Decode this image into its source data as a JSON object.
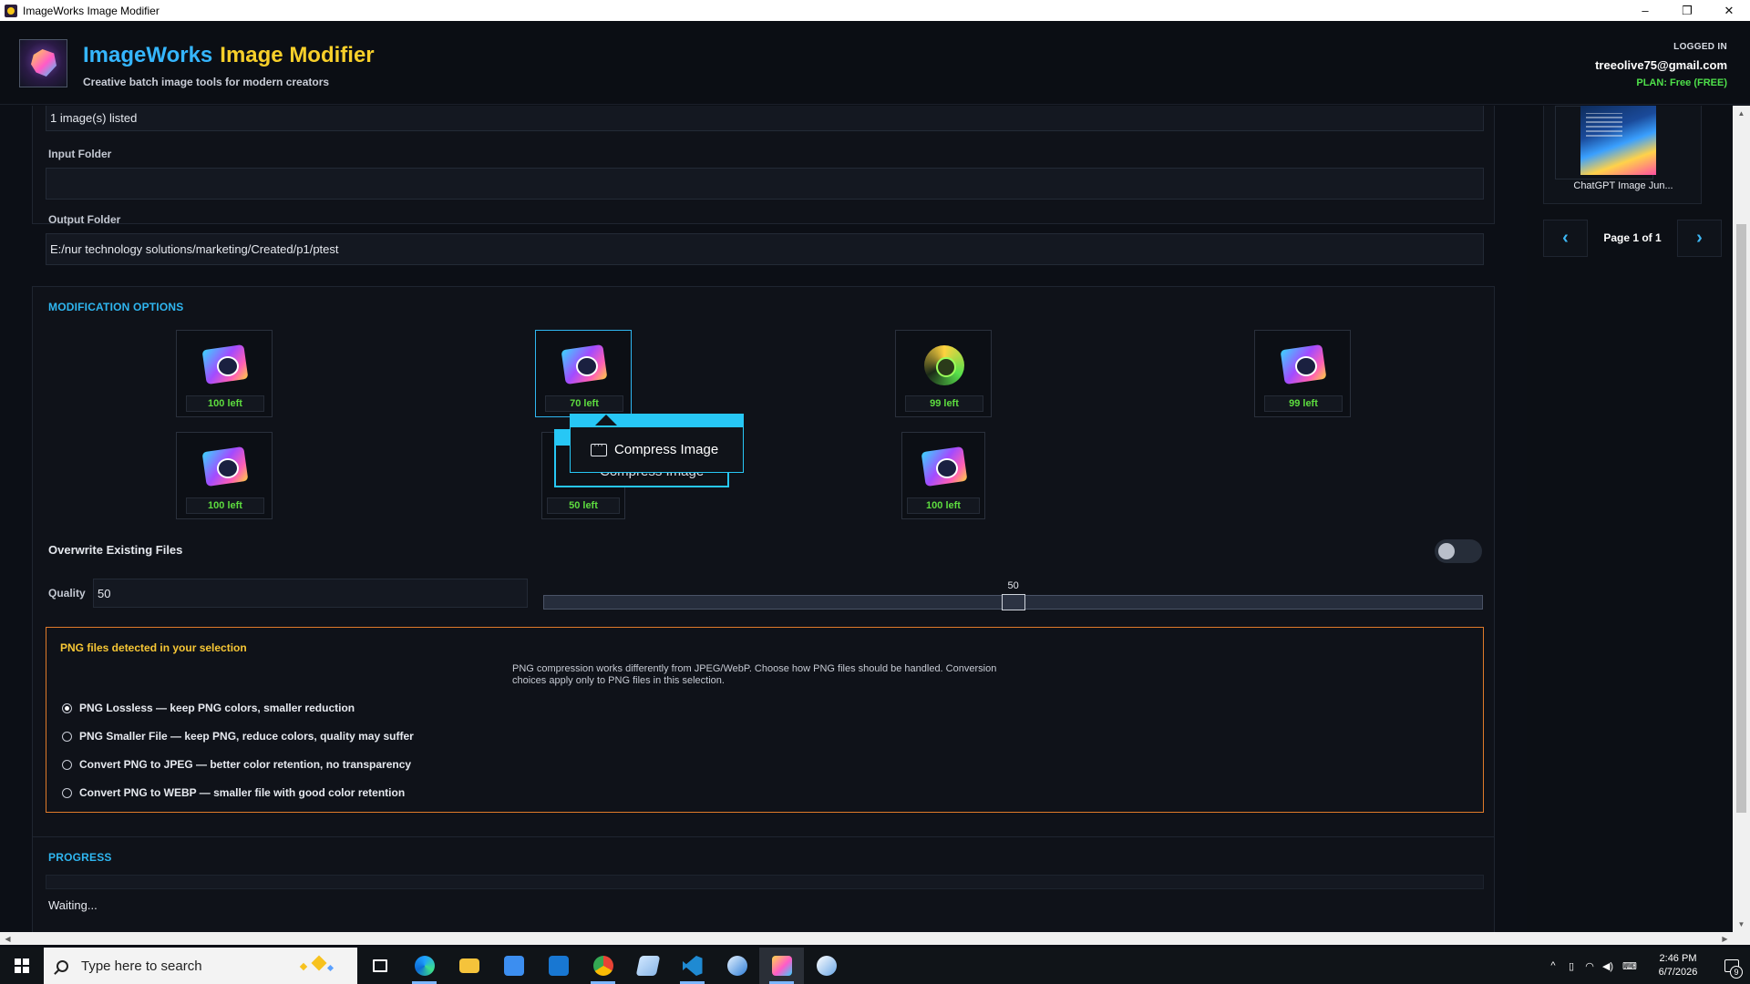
{
  "window": {
    "title": "ImageWorks Image Modifier",
    "minimize": "–",
    "restore": "❐",
    "close": "✕"
  },
  "header": {
    "brand_part1": "ImageWorks",
    "brand_part2": "Image Modifier",
    "subtitle": "Creative batch image tools for modern creators",
    "logged_in_label": "LOGGED IN",
    "email": "treeolive75@gmail.com",
    "plan": "PLAN: Free (FREE)"
  },
  "files": {
    "listed_text": "1 image(s) listed",
    "input_folder_label": "Input Folder",
    "input_folder_value": "",
    "output_folder_label": "Output Folder",
    "output_folder_value": "E:/nur technology solutions/marketing/Created/p1/ptest"
  },
  "modification": {
    "section_title": "MODIFICATION OPTIONS",
    "tools": [
      {
        "id": "tool-1",
        "remaining": "100 left",
        "icon": "image-tool-icon"
      },
      {
        "id": "tool-2",
        "remaining": "70 left",
        "icon": "compress-image-icon",
        "active": true
      },
      {
        "id": "tool-3",
        "remaining": "99 left",
        "icon": "gear-badge-icon"
      },
      {
        "id": "tool-4",
        "remaining": "99 left",
        "icon": "image-edit-icon"
      },
      {
        "id": "tool-5",
        "remaining": "100 left",
        "icon": "camera-image-icon"
      },
      {
        "id": "tool-6",
        "remaining": "50 left",
        "icon": "image-tool-icon"
      },
      {
        "id": "tool-7",
        "remaining": "100 left",
        "icon": "image-tool-icon"
      }
    ],
    "tooltip_text": "Compress Image",
    "tooltip_ghost_text": "Compress Image"
  },
  "overwrite": {
    "label": "Overwrite Existing Files",
    "enabled": false
  },
  "quality": {
    "label": "Quality",
    "value": "50",
    "slider_value": 50,
    "slider_min": 0,
    "slider_max": 100,
    "slider_label": "50"
  },
  "png": {
    "title": "PNG files detected in your selection",
    "description": "PNG compression works differently from JPEG/WebP. Choose how PNG files should be handled. Conversion choices apply only to PNG files in this selection.",
    "options": [
      {
        "label": "PNG Lossless — keep PNG colors, smaller reduction",
        "selected": true
      },
      {
        "label": "PNG Smaller File — keep PNG, reduce colors, quality may suffer",
        "selected": false
      },
      {
        "label": "Convert PNG to JPEG — better color retention, no transparency",
        "selected": false
      },
      {
        "label": "Convert PNG to WEBP — smaller file with good color retention",
        "selected": false
      }
    ]
  },
  "progress": {
    "section_title": "PROGRESS",
    "value": 0,
    "status": "Waiting..."
  },
  "sidebar": {
    "thumb_caption": "ChatGPT Image Jun...",
    "page_text": "Page 1 of 1",
    "prev": "‹",
    "next": "›"
  },
  "taskbar": {
    "search_placeholder": "Type here to search",
    "time": "2:46 PM",
    "date": "6/7/2026",
    "notification_count": "9"
  },
  "colors": {
    "accent": "#2fb6f0",
    "brand_blue": "#35b6ff",
    "brand_yellow": "#f7cf2a",
    "remaining_green": "#5ddc3f",
    "png_border": "#e07a2a",
    "png_title": "#f7c735"
  }
}
